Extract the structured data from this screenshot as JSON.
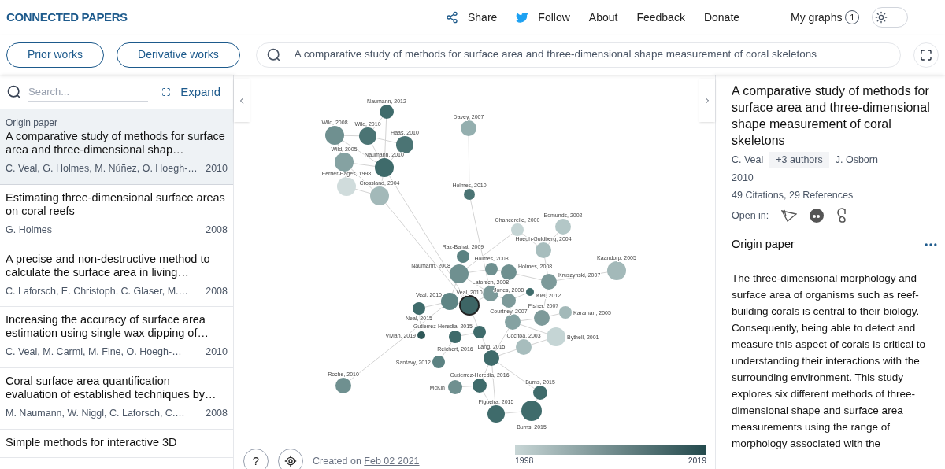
{
  "header": {
    "logo": "CONNECTED PAPERS",
    "nav": [
      {
        "kind": "share",
        "label": "Share"
      },
      {
        "kind": "follow",
        "label": "Follow"
      },
      {
        "kind": "plain",
        "label": "About"
      },
      {
        "kind": "plain",
        "label": "Feedback"
      },
      {
        "kind": "plain",
        "label": "Donate"
      }
    ],
    "my_graphs": {
      "label": "My graphs",
      "count": "1"
    },
    "dark_mode": false
  },
  "toolbar": {
    "buttons": [
      "Prior works",
      "Derivative works"
    ],
    "search_value": "A comparative study of methods for surface area and three-dimensional shape measurement of coral skeletons"
  },
  "sidebar": {
    "search_placeholder": "Search...",
    "expand": "Expand",
    "papers": [
      {
        "tag": "Origin paper",
        "title": "A comparative study of methods for surface area and three-dimensional shap…",
        "authors": "C. Veal, G. Holmes, M. Núñez, O. Hoegh-…",
        "year": "2010",
        "selected": true
      },
      {
        "title": "Estimating three-dimensional surface areas on coral reefs",
        "authors": "G. Holmes",
        "year": "2008",
        "selected": false
      },
      {
        "title": "A precise and non-destructive method to calculate the surface area in living…",
        "authors": "C. Laforsch, E. Christoph, C. Glaser, M.…",
        "year": "2008",
        "selected": false
      },
      {
        "title": "Increasing the accuracy of surface area estimation using single wax dipping of…",
        "authors": "C. Veal, M. Carmi, M. Fine, O. Hoegh-…",
        "year": "2010",
        "selected": false
      },
      {
        "title": "Coral surface area quantification–evaluation of established techniques by…",
        "authors": "M. Naumann, W. Niggl, C. Laforsch, C.…",
        "year": "2008",
        "selected": false
      },
      {
        "title": "Simple methods for interactive 3D",
        "selected": false
      }
    ]
  },
  "graph": {
    "nodes": [
      {
        "label": "Naumann, 2012",
        "color": "#3f6b6b",
        "selected": false
      },
      {
        "label": "Davey, 2007",
        "color": "#94afaf",
        "selected": false
      },
      {
        "label": "Wild, 2008",
        "color": "#6f9090",
        "selected": false
      },
      {
        "label": "Wild, 2010",
        "color": "#4b7474",
        "selected": false
      },
      {
        "label": "Haas, 2010",
        "color": "#4b7474",
        "selected": false
      },
      {
        "label": "Wild, 2005",
        "color": "#85a2a2",
        "selected": false
      },
      {
        "label": "Naumann, 2010",
        "color": "#3f6b6b",
        "selected": false
      },
      {
        "label": "Ferrier-Pagès, 1998",
        "color": "#d0dcdc",
        "selected": false
      },
      {
        "label": "Crossland, 2004",
        "color": "#a3b9b9",
        "selected": false
      },
      {
        "label": "Holmes, 2010",
        "color": "#4b7474",
        "selected": false
      },
      {
        "label": "Chancerelle, 2000",
        "color": "#c5d5d5",
        "selected": false
      },
      {
        "label": "Edmunds, 2002",
        "color": "#b3c7c7",
        "selected": false
      },
      {
        "label": "Raz-Bahat, 2009",
        "color": "#5b8282",
        "selected": false
      },
      {
        "label": "Hoegh-Guldberg, 2004",
        "color": "#a7bdbd",
        "selected": false
      },
      {
        "label": "Naumann, 2008",
        "color": "#6f9090",
        "selected": false
      },
      {
        "label": "Holmes, 2008",
        "color": "#6f9090",
        "selected": false
      },
      {
        "label": "Holmes, 2008",
        "color": "#6f9090",
        "selected": false
      },
      {
        "label": "Kaandorp, 2005",
        "color": "#a3b9b9",
        "selected": false
      },
      {
        "label": "Kruszynski, 2007",
        "color": "#7d9a9a",
        "selected": false
      },
      {
        "label": "Laforsch, 2008",
        "color": "#7d9a9a",
        "selected": false
      },
      {
        "label": "Kiel, 2012",
        "color": "#3f6b6b",
        "selected": false
      },
      {
        "label": "Veal, 2010",
        "color": "#5f8585",
        "selected": false
      },
      {
        "label": "Neal, 2015",
        "color": "#3f6b6b",
        "selected": false
      },
      {
        "label": "Veal, 2010",
        "color": "#3d6565",
        "selected": true
      },
      {
        "label": "Jones, 2008",
        "color": "#7d9a9a",
        "selected": false
      },
      {
        "label": "Courtney, 2007",
        "color": "#85a2a2",
        "selected": false
      },
      {
        "label": "Fisher, 2007",
        "color": "#7d9a9a",
        "selected": false
      },
      {
        "label": "Karaman, 2005",
        "color": "#a3b9b9",
        "selected": false
      },
      {
        "label": "Gutierrez-Heredia, 2015",
        "color": "#3f6b6b",
        "selected": false
      },
      {
        "label": "Vivian, 2019",
        "color": "#2f5858",
        "selected": false
      },
      {
        "label": "Cocitoa, 2003",
        "color": "#a7bdbd",
        "selected": false
      },
      {
        "label": "Bythell, 2001",
        "color": "#c5d5d5",
        "selected": false
      },
      {
        "label": "Reichert, 2016",
        "color": "#3f6b6b",
        "selected": false
      },
      {
        "label": "Lang, 2015",
        "color": "#3f6b6b",
        "selected": false
      },
      {
        "label": "Santavy, 2012",
        "color": "#5b8282",
        "selected": false
      },
      {
        "label": "Roche, 2010",
        "color": "#6f9090",
        "selected": false
      },
      {
        "label": "McKin",
        "color": "#6f9090",
        "selected": false
      },
      {
        "label": "Gutierrez-Heredia, 2016",
        "color": "#3f6b6b",
        "selected": false
      },
      {
        "label": "Burns, 2015",
        "color": "#3f6b6b",
        "selected": false
      },
      {
        "label": "Figueira, 2015",
        "color": "#3f6b6b",
        "selected": false
      },
      {
        "label": "Burns, 2015",
        "color": "#3f6b6b",
        "selected": false
      }
    ],
    "help": "?",
    "created_label": "Created on",
    "created_date": "Feb 02 2021",
    "legend": {
      "from": "1998",
      "to": "2019"
    }
  },
  "details": {
    "title": "A comparative study of methods for surface area and three-dimensional shape measurement of coral skeletons",
    "first_author": "C. Veal",
    "more_authors": "+3 authors",
    "last_author": "J. Osborn",
    "year": "2010",
    "stats": "49 Citations, 29 References",
    "open_in": "Open in:",
    "section": "Origin paper",
    "abstract": "The three-dimensional morphology and surface area of organisms such as reef-building corals is central to their biology. Consequently, being able to detect and measure this aspect of corals is critical to understanding their interactions with the surrounding environment. This study explores six different methods of three-dimensional shape and surface area measurements using the range of morphology associated with the"
  }
}
